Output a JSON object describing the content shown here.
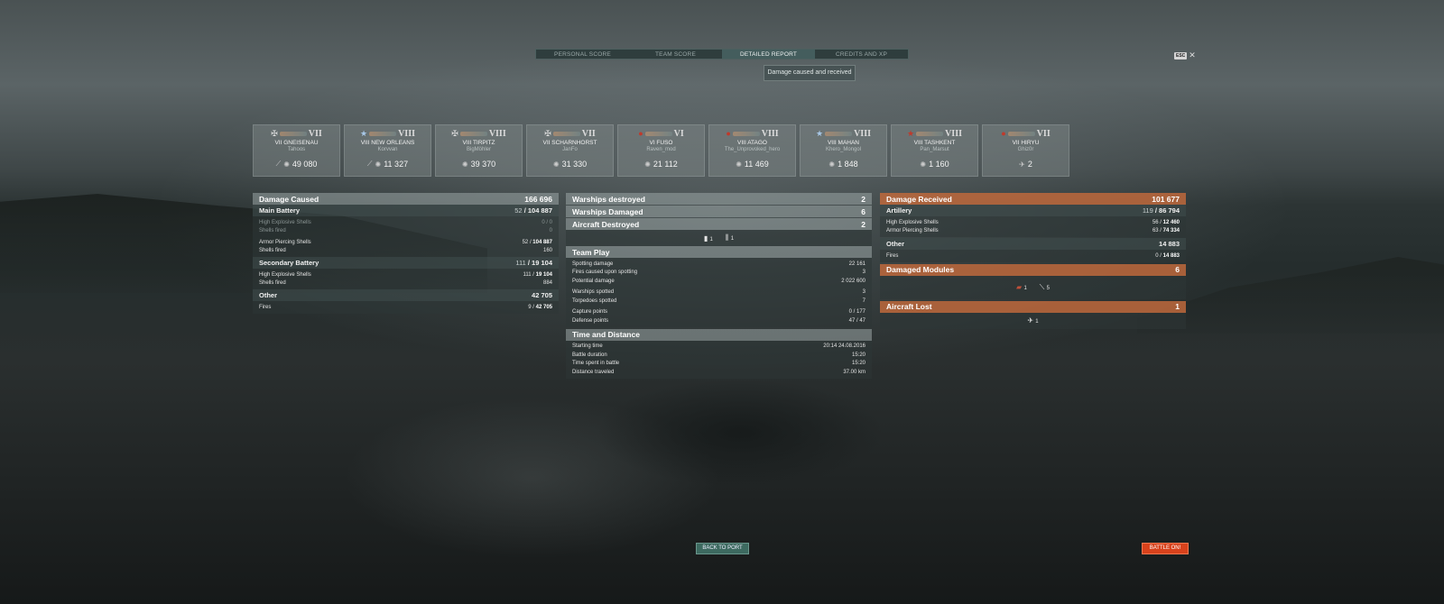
{
  "tabs": [
    "PERSONAL SCORE",
    "TEAM SCORE",
    "DETAILED REPORT",
    "CREDITS AND XP"
  ],
  "subtab": "Damage caused and received",
  "esc": {
    "key": "ESC",
    "close": "✕"
  },
  "cards": [
    {
      "tier": "VII",
      "name": "VII GNEISENAU",
      "player": "Tahoos",
      "value": "49 080",
      "nation": "germany"
    },
    {
      "tier": "VIII",
      "name": "VIII NEW ORLEANS",
      "player": "Korvvan",
      "value": "11 327",
      "nation": "usa"
    },
    {
      "tier": "VIII",
      "name": "VIII TIRPITZ",
      "player": "BigMöhler",
      "value": "39 370",
      "nation": "germany"
    },
    {
      "tier": "VII",
      "name": "VII SCHARNHORST",
      "player": "JanFo",
      "value": "31 330",
      "nation": "germany"
    },
    {
      "tier": "VI",
      "name": "VI FUSO",
      "player": "Raven_mod",
      "value": "21 112",
      "nation": "japan"
    },
    {
      "tier": "VIII",
      "name": "VIII ATAGO",
      "player": "The_Unprovoked_hero",
      "value": "11 469",
      "nation": "japan"
    },
    {
      "tier": "VIII",
      "name": "VIII MAHAN",
      "player": "Khero_Mongol",
      "value": "1 848",
      "nation": "usa"
    },
    {
      "tier": "VIII",
      "name": "VIII TASHKENT",
      "player": "Pan_Marsut",
      "value": "1 160",
      "nation": "ussr"
    },
    {
      "tier": "VII",
      "name": "VII HIRYU",
      "player": "Ghiz0r",
      "value": "2",
      "nation": "japan"
    }
  ],
  "left": {
    "header": {
      "label": "Damage Caused",
      "value": "166 696"
    },
    "main_battery": {
      "label": "Main Battery",
      "hits": "52",
      "value": "104 887"
    },
    "main_lines": [
      {
        "label": "High Explosive Shells",
        "value": "0 / 0",
        "dim": true
      },
      {
        "label": "Shells fired",
        "value": "0",
        "dim": true
      },
      {
        "label": "Armor Piercing Shells",
        "hits": "52",
        "value": "104 887",
        "dim": false
      },
      {
        "label": "Shells fired",
        "value": "160",
        "dim": false
      }
    ],
    "secondary": {
      "label": "Secondary Battery",
      "hits": "111",
      "value": "19 104"
    },
    "secondary_lines": [
      {
        "label": "High Explosive Shells",
        "hits": "111",
        "value": "19 104"
      },
      {
        "label": "Shells fired",
        "value": "884"
      }
    ],
    "other": {
      "label": "Other",
      "value": "42 705"
    },
    "other_lines": [
      {
        "label": "Fires",
        "hits": "9",
        "value": "42 705"
      }
    ]
  },
  "middle": {
    "warships_destroyed": {
      "label": "Warships destroyed",
      "value": "2"
    },
    "warships_damaged": {
      "label": "Warships Damaged",
      "value": "6"
    },
    "aircraft_destroyed": {
      "label": "Aircraft Destroyed",
      "value": "2"
    },
    "aircraft_icons": [
      {
        "icon": "fighter-icon",
        "count": "1"
      },
      {
        "icon": "torpedo-bomber-icon",
        "count": "1"
      }
    ],
    "team_play": {
      "label": "Team Play"
    },
    "team_lines": [
      {
        "label": "Spotting damage",
        "value": "22 161"
      },
      {
        "label": "Fires caused upon spotting",
        "value": "3"
      },
      {
        "label": "Potential damage",
        "value": "2 022 600"
      },
      {
        "label": "Warships spotted",
        "value": "3"
      },
      {
        "label": "Torpedoes spotted",
        "value": "7"
      },
      {
        "label": "Capture points",
        "value": "0 / 177"
      },
      {
        "label": "Defense points",
        "value": "47 / 47"
      }
    ],
    "time": {
      "label": "Time and Distance"
    },
    "time_lines": [
      {
        "label": "Starting time",
        "value": "20:14  24.08.2016"
      },
      {
        "label": "Battle duration",
        "value": "15:20"
      },
      {
        "label": "Time spent in battle",
        "value": "15:20"
      },
      {
        "label": "Distance traveled",
        "value": "37.00 km"
      }
    ]
  },
  "right": {
    "header": {
      "label": "Damage Received",
      "value": "101 677"
    },
    "artillery": {
      "label": "Artillery",
      "hits": "119",
      "value": "86 794"
    },
    "artillery_lines": [
      {
        "label": "High Explosive Shells",
        "hits": "56",
        "value": "12 460"
      },
      {
        "label": "Armor Piercing Shells",
        "hits": "63",
        "value": "74 334"
      }
    ],
    "other": {
      "label": "Other",
      "value": "14 883"
    },
    "other_lines": [
      {
        "label": "Fires",
        "hits": "0",
        "value": "14 883"
      }
    ],
    "modules": {
      "label": "Damaged Modules",
      "value": "6",
      "icons": [
        {
          "icon": "engine-icon",
          "count": "1"
        },
        {
          "icon": "steering-icon",
          "count": "5"
        }
      ]
    },
    "aircraft_lost": {
      "label": "Aircraft Lost",
      "value": "1",
      "icons": [
        {
          "icon": "plane-icon",
          "count": "1"
        }
      ]
    }
  },
  "buttons": {
    "back": "BACK TO PORT",
    "battle": "BATTLE ON!"
  },
  "colors": {
    "orange_header": "#be693c",
    "battle_button": "#d8421c",
    "port_button": "#3d6a60"
  }
}
